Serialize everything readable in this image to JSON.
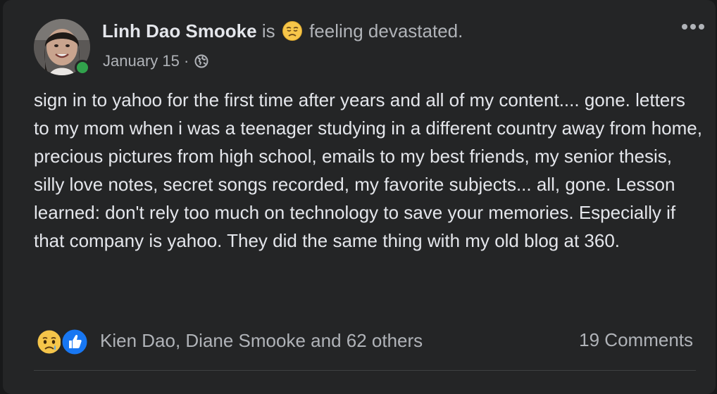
{
  "post": {
    "author": "Linh Dao Smooke",
    "feeling_prefix": "is",
    "feeling_text": "feeling devastated.",
    "feeling_icon": "disappointed-face-emoji",
    "date": "January 15",
    "date_separator": "·",
    "audience_icon": "globe-icon",
    "online": true,
    "more_icon": "more-options-icon",
    "body": "sign in to yahoo for the first time after years and all of my content.... gone. letters to my mom when i was a teenager studying in a different country away from home, precious pictures from high school, emails to my best friends, my senior thesis, silly love notes, secret songs recorded, my favorite subjects... all, gone. Lesson learned: don't rely too much on technology to save your memories. Especially if that company is yahoo. They did the same thing with my old blog at 360."
  },
  "footer": {
    "reaction_icons": [
      "sad-reaction-icon",
      "like-reaction-icon"
    ],
    "reactors": "Kien Dao, Diane Smooke and 62 others",
    "comments": "19 Comments"
  },
  "colors": {
    "background": "#18191a",
    "card": "#242526",
    "primary_text": "#e4e6eb",
    "secondary_text": "#b0b3b8",
    "online_green": "#31a24c",
    "like_blue": "#1877f2",
    "divider": "#3e4042"
  }
}
